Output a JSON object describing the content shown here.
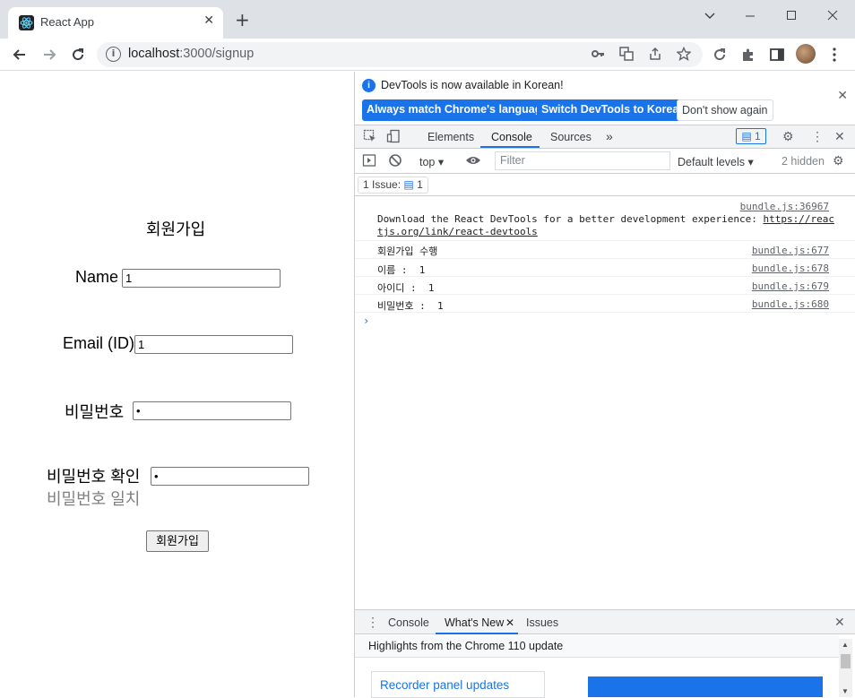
{
  "browser": {
    "tab_title": "React App",
    "new_tab_symbol": "+",
    "url_host": "localhost",
    "url_rest": ":3000/signup"
  },
  "page": {
    "heading": "회원가입",
    "name_label": "Name",
    "name_value": "1",
    "email_label": "Email (ID)",
    "email_value": "1",
    "password_label": "비밀번호",
    "password_value": "•",
    "password_confirm_label": "비밀번호 확인",
    "password_confirm_value": "•",
    "password_match_text": "비밀번호 일치",
    "submit_label": "회원가입"
  },
  "devtools": {
    "info_message": "DevTools is now available in Korean!",
    "btn_match_language": "Always match Chrome's language",
    "btn_switch_korean": "Switch DevTools to Korean",
    "btn_dont_show": "Don't show again",
    "tabs": {
      "elements": "Elements",
      "console": "Console",
      "sources": "Sources",
      "more": "»"
    },
    "issue_badge_count": "1",
    "filter": {
      "context": "top",
      "placeholder": "Filter",
      "levels": "Default levels",
      "hidden": "2 hidden"
    },
    "issues_chip_label": "1 Issue:",
    "issues_chip_count": "1",
    "console": {
      "messages": [
        {
          "source": "bundle.js:36967",
          "text1": "Download the React DevTools for a better development experience: ",
          "link1": "https://reac",
          "link2": "tjs.org/link/react-devtools"
        },
        {
          "source": "bundle.js:677",
          "text": "회원가입 수행"
        },
        {
          "source": "bundle.js:678",
          "text": "이름 :  1"
        },
        {
          "source": "bundle.js:679",
          "text": "아이디 :  1"
        },
        {
          "source": "bundle.js:680",
          "text": "비밀번호 :  1"
        }
      ],
      "prompt": "›"
    },
    "drawer": {
      "tab_console": "Console",
      "tab_whats_new": "What's New",
      "tab_issues": "Issues",
      "highlights": "Highlights from the Chrome 110 update",
      "card_title": "Recorder panel updates"
    }
  },
  "colors": {
    "accent": "#1a73e8",
    "frame": "#dee1e6"
  }
}
